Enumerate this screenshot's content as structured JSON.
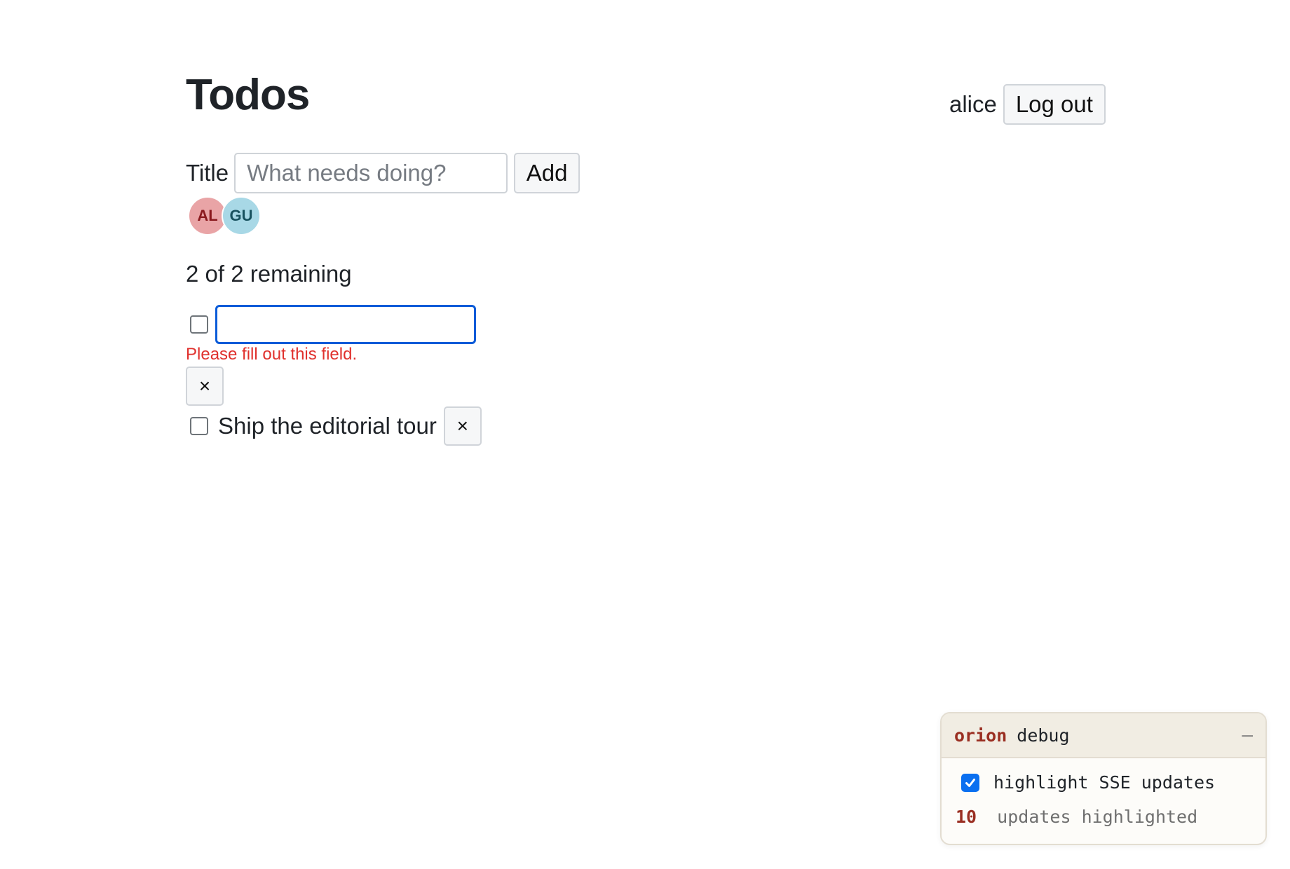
{
  "header": {
    "title": "Todos",
    "username": "alice",
    "logout_label": "Log out"
  },
  "add_form": {
    "title_label": "Title",
    "title_placeholder": "What needs doing?",
    "title_value": "",
    "add_label": "Add"
  },
  "avatars": [
    {
      "initials": "AL",
      "color": "#e9a4a6"
    },
    {
      "initials": "GU",
      "color": "#a8d8e6"
    }
  ],
  "remaining_text": "2 of 2 remaining",
  "todos": [
    {
      "text": "",
      "done": false,
      "editing": true,
      "validation_message": "Please fill out this field.",
      "delete_label": "×"
    },
    {
      "text": "Ship the editorial tour",
      "done": false,
      "editing": false,
      "delete_label": "×"
    }
  ],
  "debug_panel": {
    "brand": "orion",
    "title": "debug",
    "minimize_label": "–",
    "option_label": "highlight SSE updates",
    "option_checked": true,
    "update_count": "10",
    "update_label": "updates highlighted"
  },
  "colors": {
    "focus_ring": "#0a5bd8",
    "error_text": "#e0312d",
    "debug_brand": "#9a2f22",
    "checkbox_checked": "#0a6ff0"
  }
}
